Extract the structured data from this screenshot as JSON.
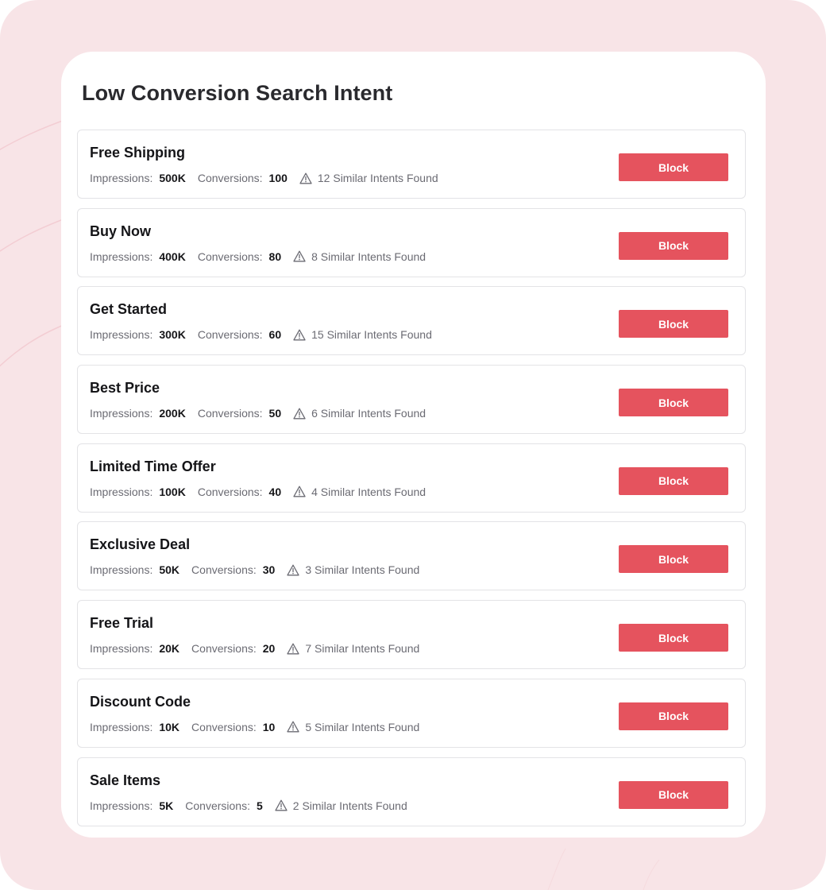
{
  "panel": {
    "title": "Low Conversion Search Intent"
  },
  "labels": {
    "impressions": "Impressions:",
    "conversions": "Conversions:"
  },
  "colors": {
    "page_background": "#f8e4e7",
    "block_button": "#e5535e"
  },
  "icons": {
    "similar_warning": "warning-triangle-icon"
  },
  "intents": [
    {
      "name": "Free Shipping",
      "impressions": "500K",
      "conversions": "100",
      "similar": "12 Similar Intents Found",
      "action": "Block"
    },
    {
      "name": "Buy Now",
      "impressions": "400K",
      "conversions": "80",
      "similar": "8 Similar Intents Found",
      "action": "Block"
    },
    {
      "name": "Get Started",
      "impressions": "300K",
      "conversions": "60",
      "similar": "15 Similar Intents Found",
      "action": "Block"
    },
    {
      "name": "Best Price",
      "impressions": "200K",
      "conversions": "50",
      "similar": "6 Similar Intents Found",
      "action": "Block"
    },
    {
      "name": "Limited Time Offer",
      "impressions": "100K",
      "conversions": "40",
      "similar": "4 Similar Intents Found",
      "action": "Block"
    },
    {
      "name": "Exclusive Deal",
      "impressions": "50K",
      "conversions": "30",
      "similar": "3 Similar Intents Found",
      "action": "Block"
    },
    {
      "name": "Free Trial",
      "impressions": "20K",
      "conversions": "20",
      "similar": "7 Similar Intents Found",
      "action": "Block"
    },
    {
      "name": "Discount Code",
      "impressions": "10K",
      "conversions": "10",
      "similar": "5 Similar Intents Found",
      "action": "Block"
    },
    {
      "name": "Sale Items",
      "impressions": "5K",
      "conversions": "5",
      "similar": "2 Similar Intents Found",
      "action": "Block"
    }
  ]
}
